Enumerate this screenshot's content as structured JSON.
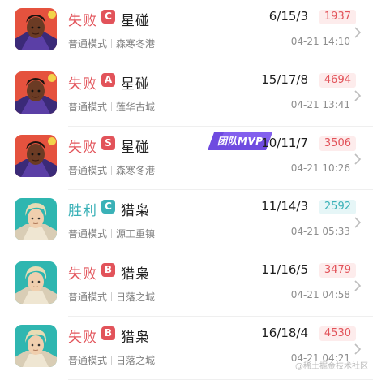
{
  "colors": {
    "lose": "#e2535a",
    "win": "#3ab1b7"
  },
  "matches": [
    {
      "result": "失败",
      "outcome": "lose",
      "grade": "C",
      "grade_color": "#e2535a",
      "hero": "星碰",
      "hero_avatar": "dark-skinned-hero-avatar",
      "mode": "普通模式",
      "map": "森寒冬港",
      "kda": "6/15/3",
      "score": "1937",
      "time": "04-21 14:10",
      "mvp": ""
    },
    {
      "result": "失败",
      "outcome": "lose",
      "grade": "A",
      "grade_color": "#e2535a",
      "hero": "星碰",
      "hero_avatar": "dark-skinned-hero-avatar",
      "mode": "普通模式",
      "map": "莲华古城",
      "kda": "15/17/8",
      "score": "4694",
      "time": "04-21 13:41",
      "mvp": ""
    },
    {
      "result": "失败",
      "outcome": "lose",
      "grade": "S",
      "grade_color": "#e2535a",
      "hero": "星碰",
      "hero_avatar": "dark-skinned-hero-avatar",
      "mode": "普通模式",
      "map": "森寒冬港",
      "kda": "10/11/7",
      "score": "3506",
      "time": "04-21 10:26",
      "mvp": "团队MVP"
    },
    {
      "result": "胜利",
      "outcome": "win",
      "grade": "C",
      "grade_color": "#3ab1b7",
      "hero": "猎枭",
      "hero_avatar": "blonde-hero-avatar",
      "mode": "普通模式",
      "map": "源工重镇",
      "kda": "11/14/3",
      "score": "2592",
      "time": "04-21 05:33",
      "mvp": ""
    },
    {
      "result": "失败",
      "outcome": "lose",
      "grade": "B",
      "grade_color": "#e2535a",
      "hero": "猎枭",
      "hero_avatar": "blonde-hero-avatar",
      "mode": "普通模式",
      "map": "日落之城",
      "kda": "11/16/5",
      "score": "3479",
      "time": "04-21 04:58",
      "mvp": ""
    },
    {
      "result": "失败",
      "outcome": "lose",
      "grade": "B",
      "grade_color": "#e2535a",
      "hero": "猎枭",
      "hero_avatar": "blonde-hero-avatar",
      "mode": "普通模式",
      "map": "日落之城",
      "kda": "16/18/4",
      "score": "4530",
      "time": "04-21 04:21",
      "mvp": ""
    }
  ],
  "watermark": "@稀土掘金技术社区"
}
